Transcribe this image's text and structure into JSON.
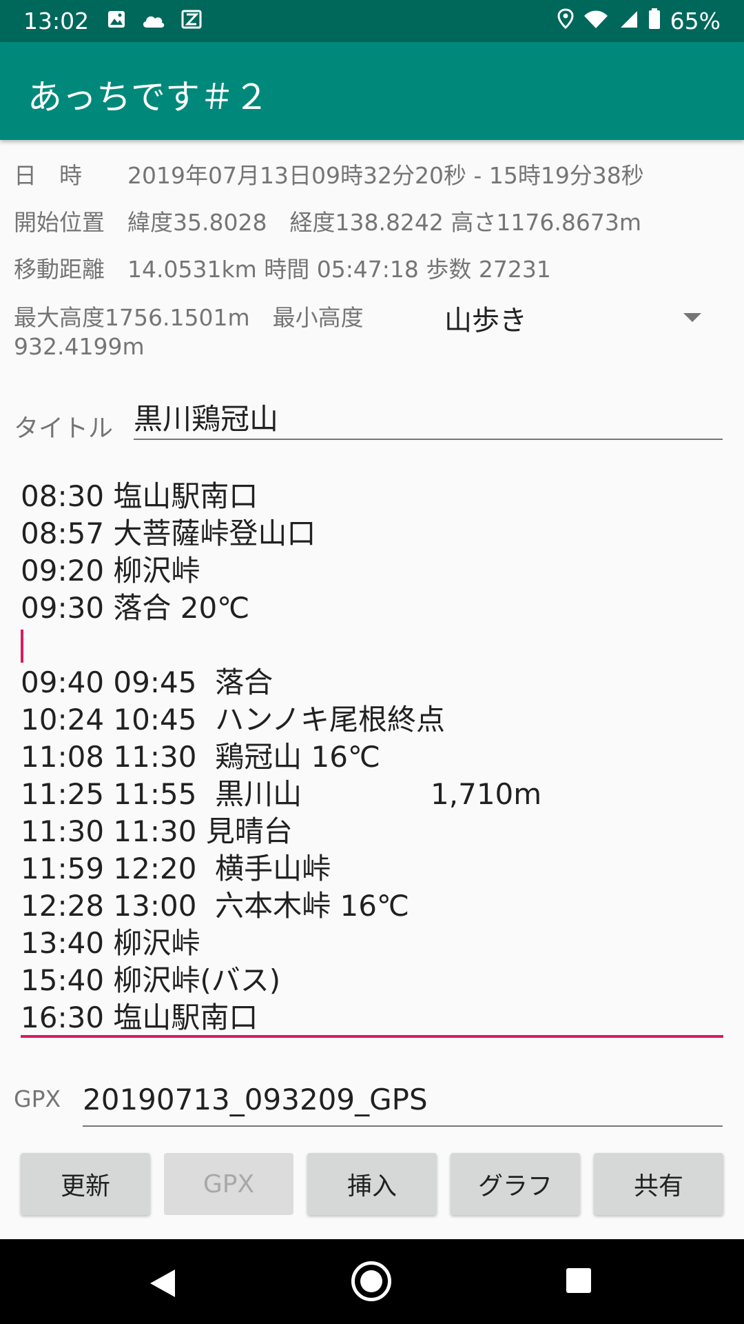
{
  "status_bar": {
    "time": "13:02",
    "battery": "65%",
    "left_icons": [
      "image-icon",
      "cloud-icon",
      "app-icon"
    ],
    "right_icons": [
      "location-icon",
      "wifi-icon",
      "signal-icon",
      "battery-icon"
    ]
  },
  "app_bar": {
    "title": "あっちです＃２"
  },
  "info": {
    "date_label": "日　時",
    "date_value": "2019年07月13日09時32分20秒 - 15時19分38秒",
    "position_label": "開始位置",
    "position_value": "緯度35.8028　経度138.8242 高さ1176.8673m",
    "distance_label": "移動距離",
    "distance_value": "14.0531km 時間 05:47:18 歩数 27231",
    "altitude_text": "最大高度1756.1501m　最小高度 932.4199m"
  },
  "activity_spinner": {
    "selected": "山歩き"
  },
  "title_field": {
    "label": "タイトル",
    "value": "黒川鶏冠山"
  },
  "notes": [
    "08:30 塩山駅南口",
    "08:57 大菩薩峠登山口",
    "09:20 柳沢峠",
    "09:30 落合 20℃",
    "",
    "09:40 09:45  落合",
    "10:24 10:45  ハンノキ尾根終点",
    "11:08 11:30  鶏冠山 16℃",
    "11:25 11:55  黒川山              1,710m",
    "11:30 11:30 見晴台",
    "11:59 12:20  横手山峠",
    "12:28 13:00  六本木峠 16℃",
    "13:40 柳沢峠",
    "15:40 柳沢峠(バス)",
    "16:30 塩山駅南口"
  ],
  "gpx_field": {
    "label": "GPX",
    "value": "20190713_093209_GPS"
  },
  "buttons": {
    "update": "更新",
    "gpx": "GPX",
    "insert": "挿入",
    "graph": "グラフ",
    "share": "共有"
  },
  "colors": {
    "status_bar": "#00675b",
    "app_bar": "#00897b",
    "accent": "#d81b60"
  }
}
